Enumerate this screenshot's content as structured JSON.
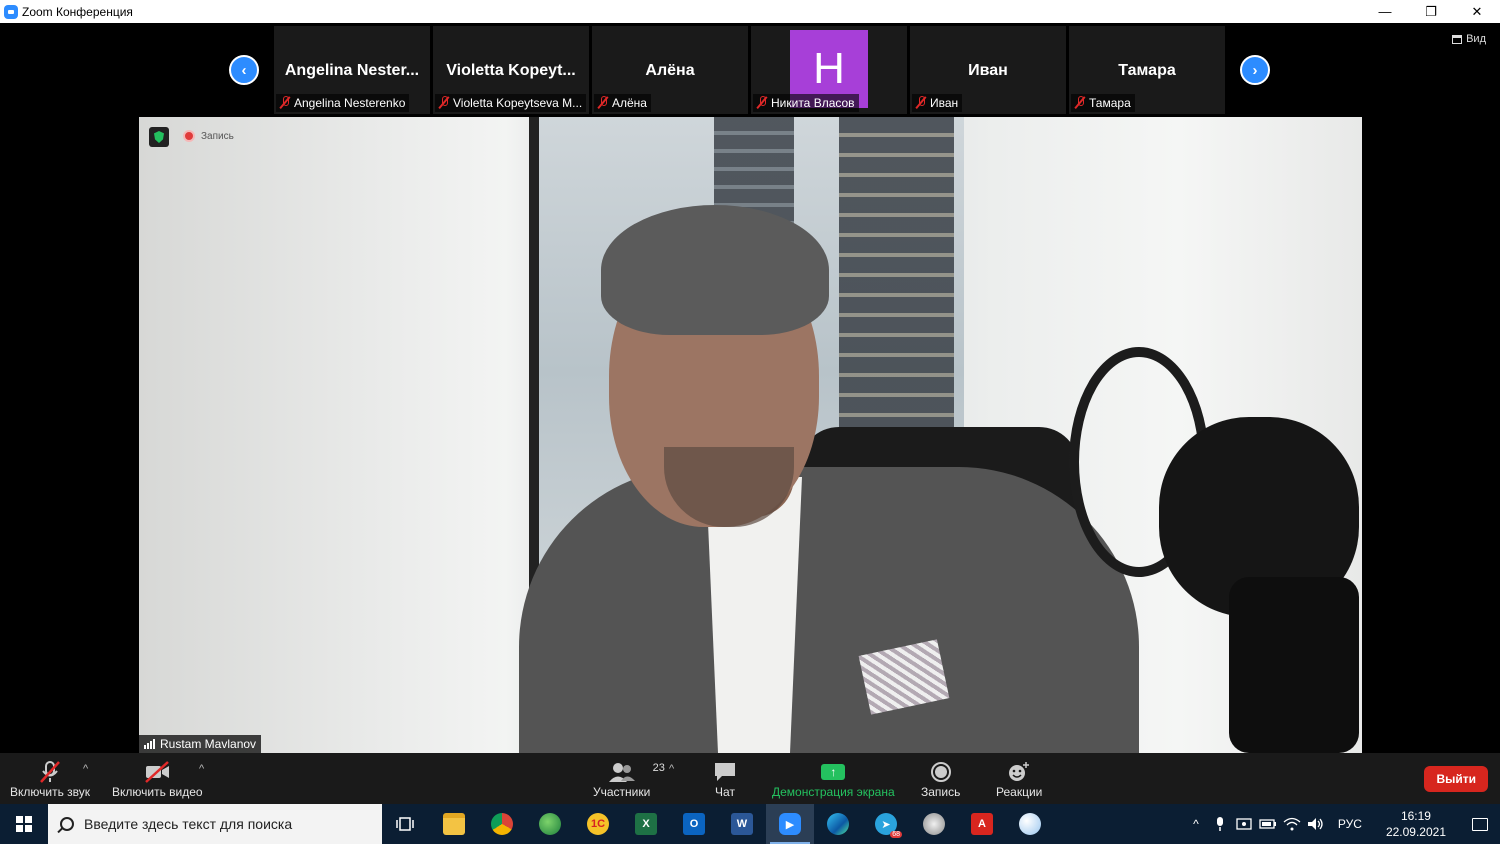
{
  "window": {
    "title": "Zoom Конференция",
    "controls": [
      "—",
      "❐",
      "✕"
    ]
  },
  "view_button": {
    "label": "Вид"
  },
  "gallery": {
    "tiles": [
      {
        "display_name": "Angelina  Nester...",
        "label": "Angelina Nesterenko"
      },
      {
        "display_name": "Violetta  Kopeyt...",
        "label": "Violetta Kopeytseva M..."
      },
      {
        "display_name": "Алёна",
        "label": "Алёна"
      },
      {
        "avatar_letter": "H",
        "label": "Никита Власов"
      },
      {
        "display_name": "Иван",
        "label": "Иван"
      },
      {
        "display_name": "Тамара",
        "label": "Тамара"
      }
    ],
    "prev": "‹",
    "next": "›"
  },
  "main_video": {
    "recording_label": "Запись",
    "speaker_name": "Rustam Mavlanov"
  },
  "toolbar": {
    "audio_label": "Включить звук",
    "video_label": "Включить видео",
    "participants_label": "Участники",
    "participants_count": "23",
    "chat_label": "Чат",
    "share_label": "Демонстрация экрана",
    "record_label": "Запись",
    "reactions_label": "Реакции",
    "leave_label": "Выйти",
    "caret": "^"
  },
  "taskbar": {
    "search_placeholder": "Введите здесь текст для поиска",
    "telegram_badge": "68",
    "language": "РУС",
    "time": "16:19",
    "date": "22.09.2021"
  },
  "colors": {
    "zoom_blue": "#2d8cff",
    "avatar_purple": "#a73fd8",
    "share_green": "#24c15f",
    "leave_red": "#d7261e",
    "muted_red": "#e02828",
    "taskbar_bg": "#0b1e33"
  }
}
